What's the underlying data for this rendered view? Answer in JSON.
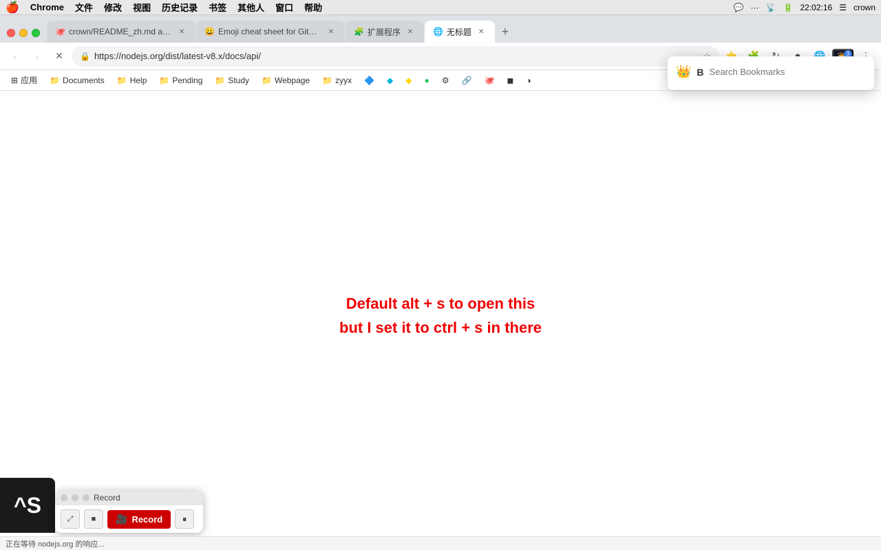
{
  "menubar": {
    "apple": "🍎",
    "items": [
      "Chrome",
      "文件",
      "修改",
      "视图",
      "历史记录",
      "书签",
      "其他人",
      "窗口",
      "帮助"
    ],
    "right": {
      "wechat": "💬",
      "dots": "···",
      "wifi": "📶",
      "battery": "🔋",
      "user": "👤",
      "time": "22:02:16",
      "menu": "☰"
    }
  },
  "tabs": [
    {
      "id": "tab1",
      "favicon": "🐙",
      "title": "crown/README_zh.md at mas...",
      "active": false,
      "closeable": true
    },
    {
      "id": "tab2",
      "favicon": "😀",
      "title": "Emoji cheat sheet for GitHub,",
      "active": false,
      "closeable": true
    },
    {
      "id": "tab3",
      "favicon": "🧩",
      "title": "扩展程序",
      "active": false,
      "closeable": true
    },
    {
      "id": "tab4",
      "favicon": "",
      "title": "无标题",
      "active": true,
      "closeable": true
    }
  ],
  "toolbar": {
    "url": "https://nodejs.org/dist/latest-v8.x/docs/api/",
    "back_disabled": false,
    "forward_disabled": true
  },
  "bookmarks": [
    {
      "id": "apps",
      "icon": "⊞",
      "label": "应用"
    },
    {
      "id": "documents",
      "icon": "📁",
      "label": "Documents"
    },
    {
      "id": "help",
      "icon": "📁",
      "label": "Help"
    },
    {
      "id": "pending",
      "icon": "📁",
      "label": "Pending"
    },
    {
      "id": "study",
      "icon": "📁",
      "label": "Study"
    },
    {
      "id": "webpage",
      "icon": "📁",
      "label": "Webpage"
    },
    {
      "id": "zyyx",
      "icon": "📁",
      "label": "zyyx"
    },
    {
      "id": "dropbox",
      "icon": "🔷",
      "label": ""
    },
    {
      "id": "ext1",
      "icon": "💠",
      "label": ""
    },
    {
      "id": "ext2",
      "icon": "🟡",
      "label": ""
    },
    {
      "id": "ext3",
      "icon": "🟢",
      "label": ""
    },
    {
      "id": "ext4",
      "icon": "⚙",
      "label": ""
    },
    {
      "id": "ext5",
      "icon": "🔗",
      "label": ""
    },
    {
      "id": "github",
      "icon": "🐙",
      "label": ""
    },
    {
      "id": "ext6",
      "icon": "◼",
      "label": ""
    },
    {
      "id": "half",
      "icon": "◑",
      "label": ""
    }
  ],
  "page": {
    "line1": "Default alt + s to open this",
    "line2": "but I set it to ctrl + s in there"
  },
  "bookmark_popup": {
    "crown_icon": "👑",
    "b_label": "B",
    "search_placeholder": "Search Bookmarks"
  },
  "record_bar": {
    "title": "Record",
    "dot1": "",
    "dot2": "",
    "dot3": "",
    "expand_icon": "⤢",
    "stop_icon": "■",
    "record_label": "Record",
    "pause_icon": "⏸"
  },
  "status_bar": {
    "text": "正在等待 nodejs.org 的响应..."
  },
  "snap_logo": "^S"
}
